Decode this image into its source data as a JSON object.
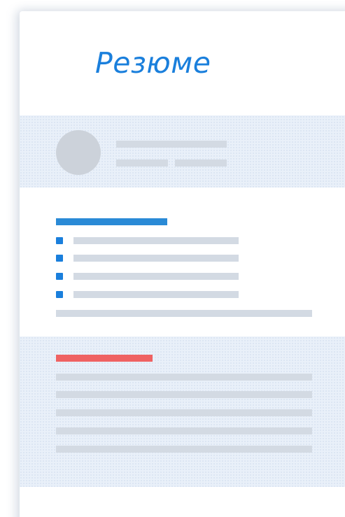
{
  "resume": {
    "title": "Резюме"
  },
  "colors": {
    "title": "#1a7fdc",
    "section1_accent": "#2a8ad6",
    "section2_accent": "#ef6262",
    "bullet": "#1a7fdc",
    "placeholder_line": "#d3dae3",
    "avatar": "#ccd2da",
    "band": "#e9f0f9"
  },
  "icons": {
    "avatar": "avatar-placeholder-icon",
    "bullet": "square-bullet-icon"
  }
}
